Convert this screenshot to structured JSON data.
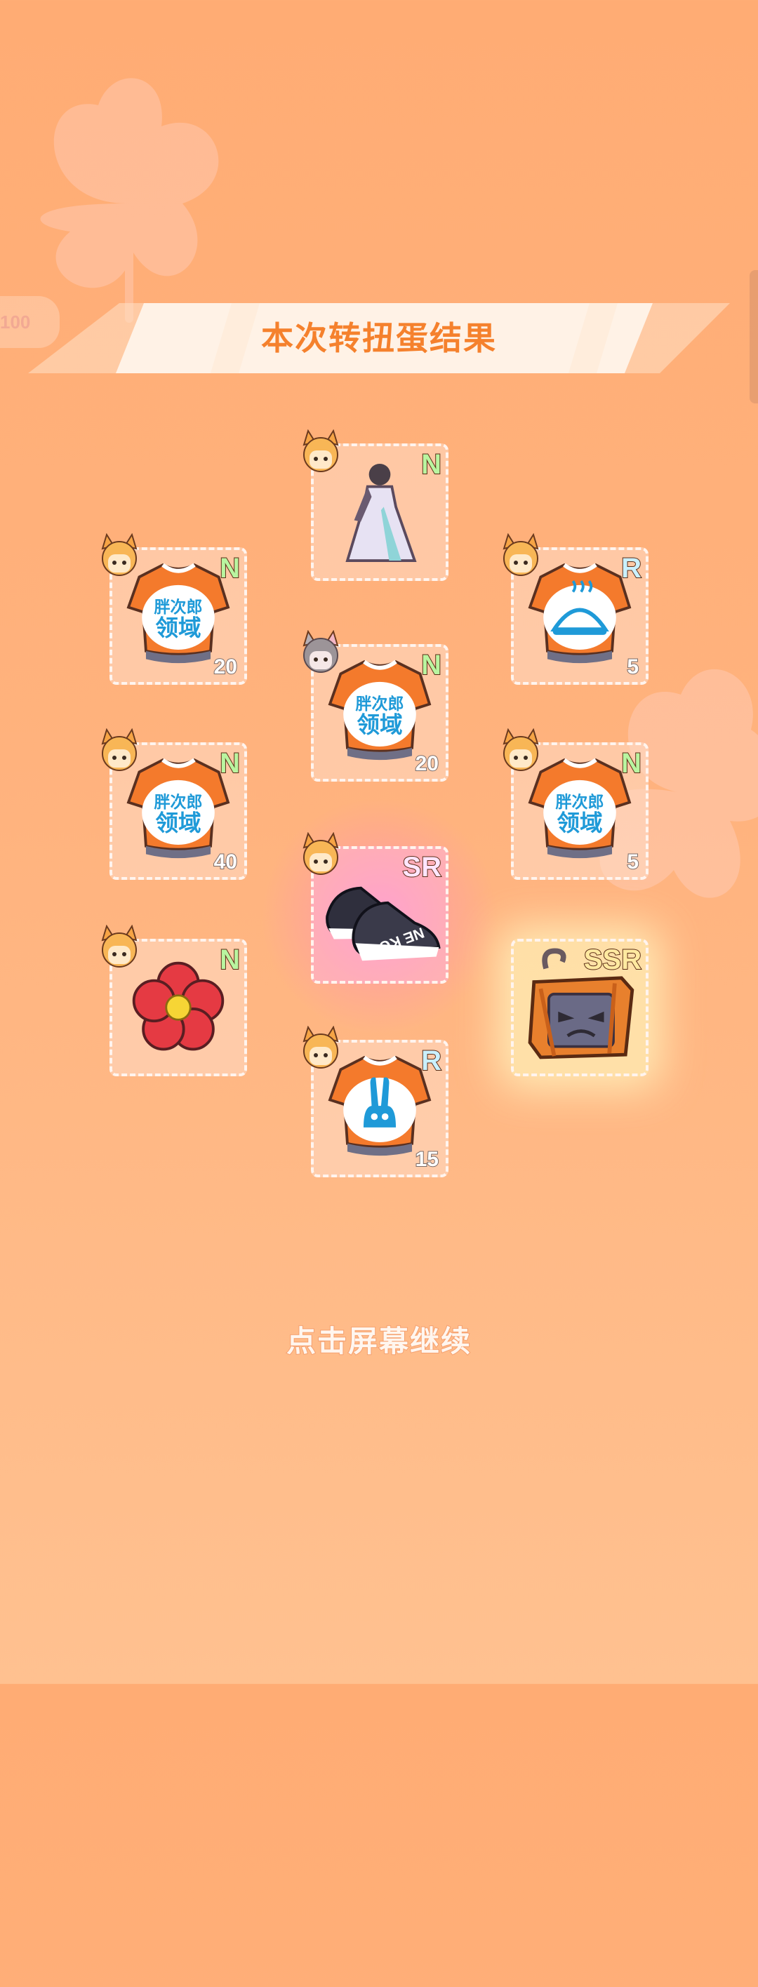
{
  "header": {
    "left_tab_value": "100",
    "title": "本次转扭蛋结果"
  },
  "colors": {
    "accent": "#f5812d",
    "background": "#ffac74"
  },
  "results": [
    {
      "id": "c1",
      "rarity": "N",
      "count": "",
      "item": "dress-icon"
    },
    {
      "id": "c2",
      "rarity": "N",
      "count": "20",
      "item": "orange-shirt-icon"
    },
    {
      "id": "c3",
      "rarity": "R",
      "count": "5",
      "item": "bun-shirt-icon"
    },
    {
      "id": "c4",
      "rarity": "N",
      "count": "20",
      "item": "orange-shirt-icon"
    },
    {
      "id": "c5",
      "rarity": "N",
      "count": "40",
      "item": "orange-shirt-icon"
    },
    {
      "id": "c6",
      "rarity": "N",
      "count": "5",
      "item": "orange-shirt-icon"
    },
    {
      "id": "c7",
      "rarity": "SR",
      "count": "",
      "item": "sneakers-icon"
    },
    {
      "id": "c8",
      "rarity": "N",
      "count": "",
      "item": "red-flower-icon"
    },
    {
      "id": "c9",
      "rarity": "SSR",
      "count": "",
      "item": "cat-box-icon"
    },
    {
      "id": "c10",
      "rarity": "R",
      "count": "15",
      "item": "bunny-shirt-icon"
    }
  ],
  "shirt_text": {
    "line1": "胖次郎",
    "line2": "领域"
  },
  "sneaker_text": "NE KO",
  "footer": {
    "continue_label": "点击屏幕继续"
  }
}
